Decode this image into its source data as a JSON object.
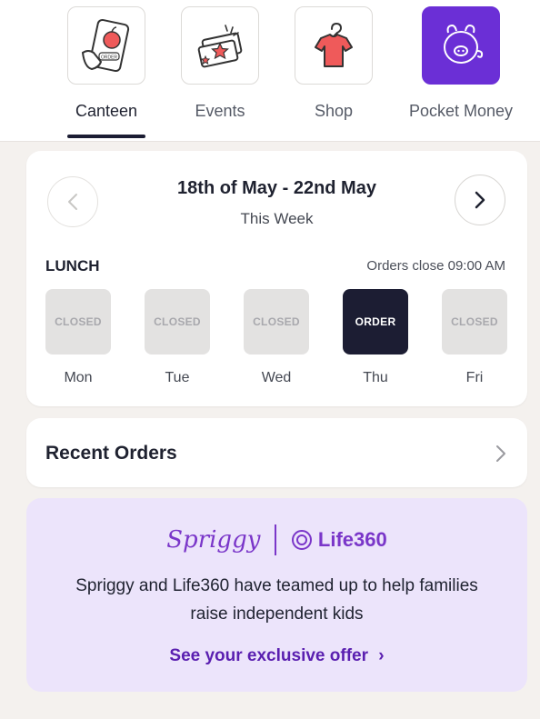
{
  "nav": {
    "tabs": [
      {
        "label": "Canteen",
        "icon": "canteen-phone-icon"
      },
      {
        "label": "Events",
        "icon": "event-tickets-icon"
      },
      {
        "label": "Shop",
        "icon": "shirt-hanger-icon"
      },
      {
        "label": "Pocket Money",
        "icon": "piggy-bank-icon"
      }
    ],
    "active_tab": "Canteen",
    "highlight_color": "#6b2fd6"
  },
  "canteen_icon_text": "ORDER",
  "week": {
    "range": "18th of May - 22nd May",
    "subtitle": "This Week",
    "meal": "LUNCH",
    "orders_close": "Orders close 09:00 AM",
    "days": [
      {
        "name": "Mon",
        "status": "CLOSED"
      },
      {
        "name": "Tue",
        "status": "CLOSED"
      },
      {
        "name": "Wed",
        "status": "CLOSED"
      },
      {
        "name": "Thu",
        "status": "ORDER"
      },
      {
        "name": "Fri",
        "status": "CLOSED"
      }
    ]
  },
  "recent": {
    "title": "Recent Orders"
  },
  "promo": {
    "brand1": "Spriggy",
    "brand2": "Life360",
    "text": "Spriggy and Life360 have teamed up to help families raise independent kids",
    "link": "See your exclusive offer",
    "link_chevron": "›",
    "accent": "#7a36c9",
    "background": "#ece4fb"
  }
}
